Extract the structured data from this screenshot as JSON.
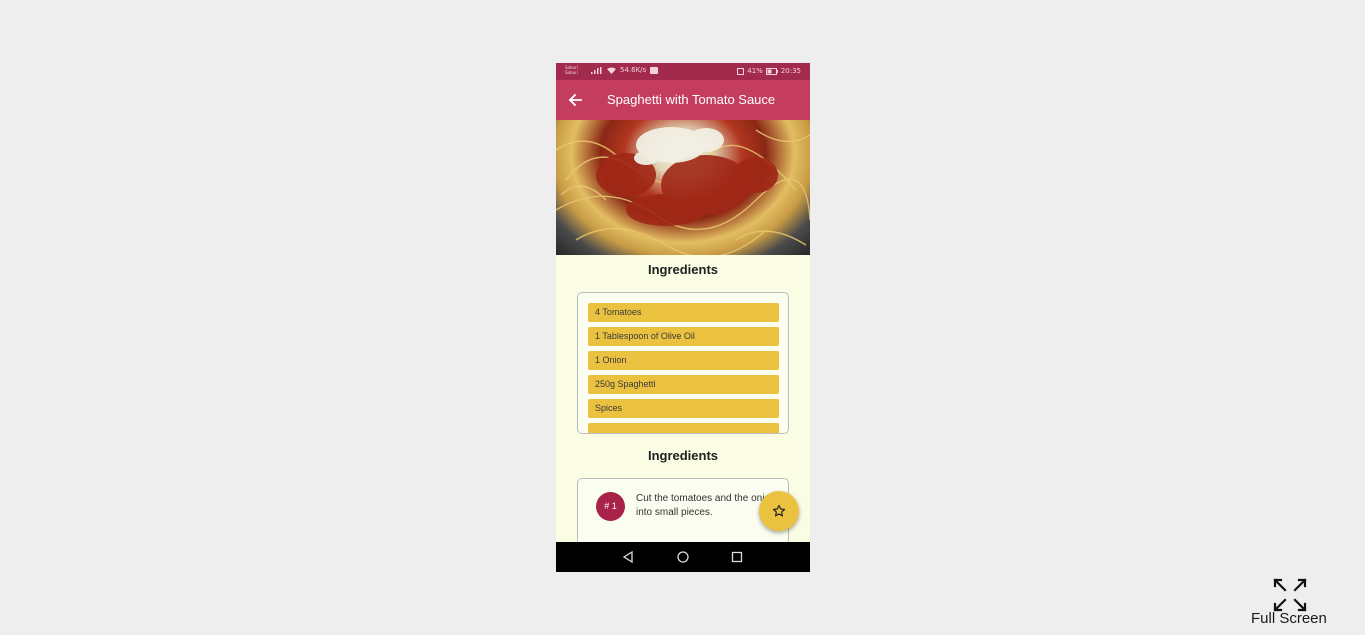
{
  "status_bar": {
    "carrier": "Sahuri Sahuri",
    "speed": "54.6K/s",
    "battery": "41%",
    "time": "20:35"
  },
  "app_bar": {
    "title": "Spaghetti with Tomato Sauce"
  },
  "ingredients_section": {
    "title": "Ingredients",
    "items": [
      "4 Tomatoes",
      "1 Tablespoon of Olive Oil",
      "1 Onion",
      "250g Spaghetti",
      "Spices"
    ]
  },
  "steps_section": {
    "title": "Ingredients",
    "steps": [
      {
        "badge": "# 1",
        "text": "Cut the tomatoes and the onion into small pieces."
      }
    ]
  },
  "fab": {
    "icon": "star-outline-icon"
  },
  "fullscreen": {
    "label": "Full Screen"
  },
  "colors": {
    "status_bar": "#a22a4c",
    "app_bar": "#c43d5f",
    "accent": "#ebc240",
    "background": "#fafce3"
  }
}
